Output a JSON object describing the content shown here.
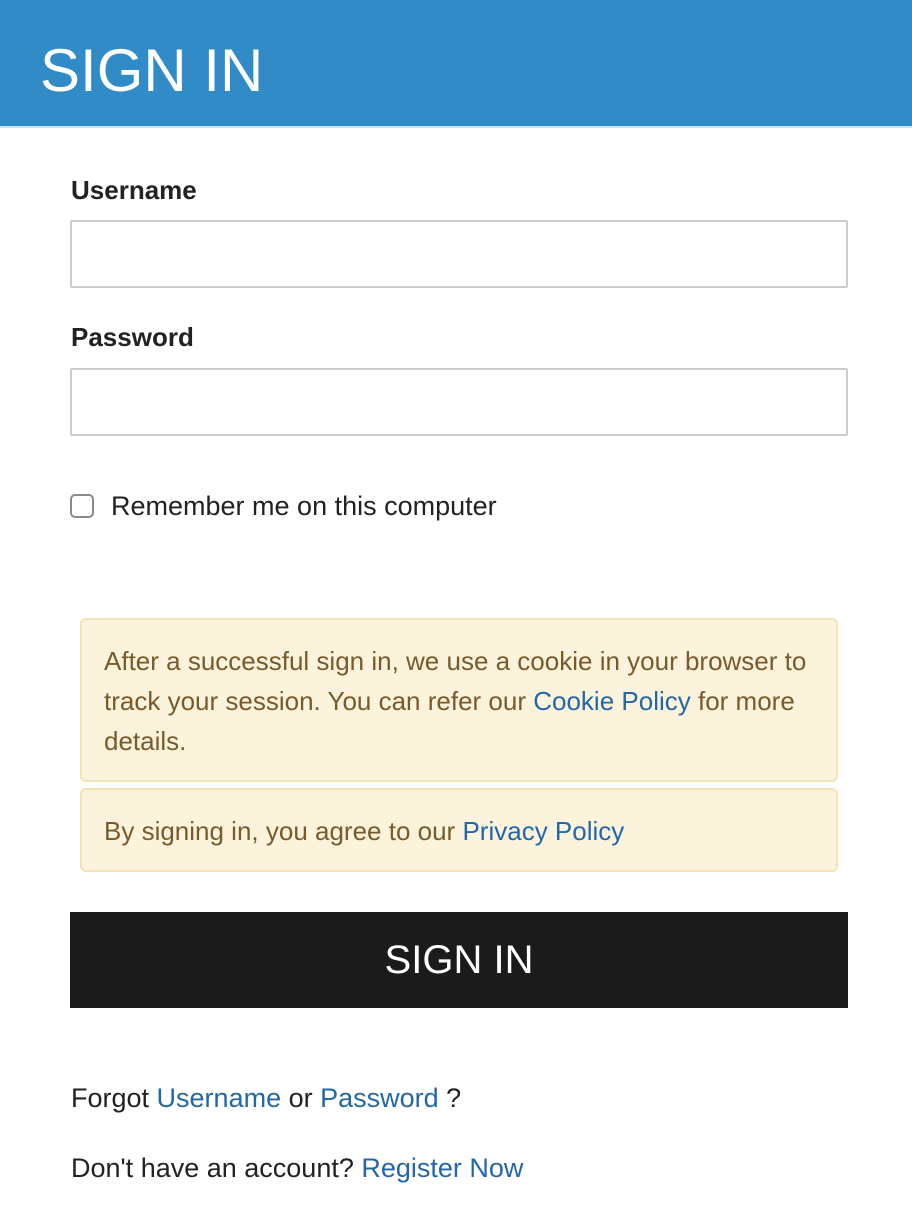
{
  "header": {
    "title": "SIGN IN"
  },
  "form": {
    "username_label": "Username",
    "username_value": "",
    "password_label": "Password",
    "password_value": "",
    "remember_label": "Remember me on this computer",
    "remember_checked": false
  },
  "notices": {
    "cookie_text_before": "After a successful sign in, we use a cookie in your browser to track your session. You can refer our ",
    "cookie_link": "Cookie Policy",
    "cookie_text_after": " for more details.",
    "privacy_text_before": "By signing in, you agree to our ",
    "privacy_link": "Privacy Policy"
  },
  "actions": {
    "signin_label": "SIGN IN"
  },
  "footer": {
    "forgot_prefix": "Forgot ",
    "forgot_username_link": "Username",
    "forgot_or": " or ",
    "forgot_password_link": "Password",
    "forgot_suffix": " ?",
    "register_prefix": "Don't have an account? ",
    "register_link": "Register Now"
  },
  "colors": {
    "header_bg": "#318bc6",
    "button_bg": "#1b1b1b",
    "link": "#2467a8",
    "notice_bg": "#fbf3dc",
    "notice_text": "#7b5a2a"
  }
}
